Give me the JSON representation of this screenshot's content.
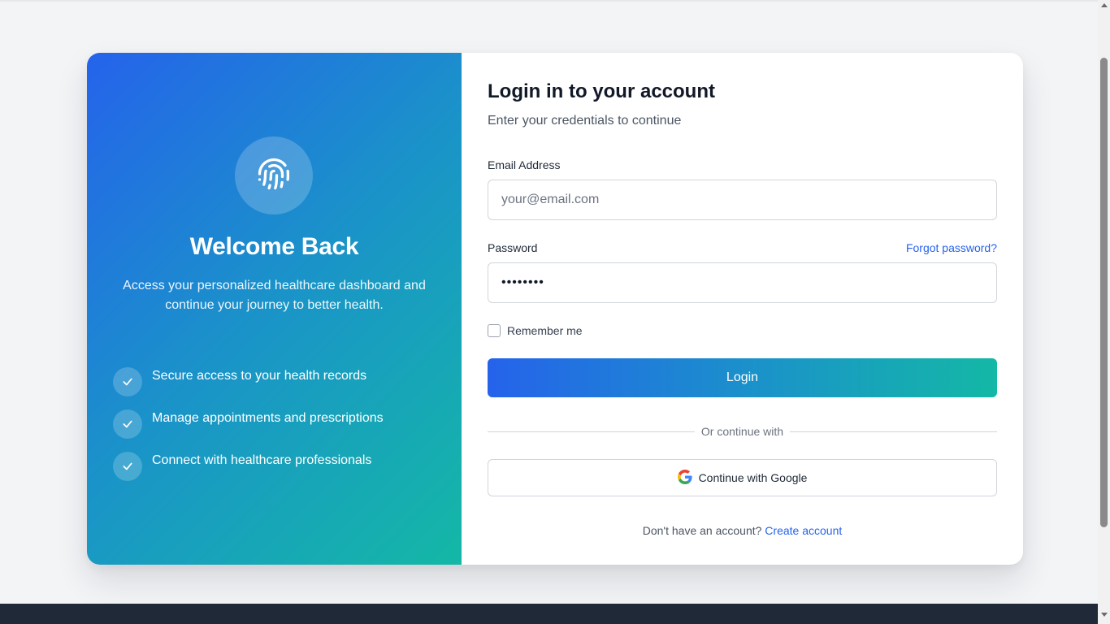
{
  "colors": {
    "brand_blue": "#2563eb",
    "brand_teal": "#14b8a6",
    "link": "#2563eb",
    "footer": "#1f2937"
  },
  "left": {
    "logo_icon": "fingerprint-icon",
    "title": "Welcome Back",
    "subtitle": "Access your personalized healthcare dashboard and continue your journey to better health.",
    "features": [
      {
        "icon": "check-icon",
        "text": "Secure access to your health records"
      },
      {
        "icon": "check-icon",
        "text": "Manage appointments and prescriptions"
      },
      {
        "icon": "check-icon",
        "text": "Connect with healthcare professionals"
      }
    ]
  },
  "form": {
    "title": "Login in to your account",
    "subtitle": "Enter your credentials to continue",
    "email_label": "Email Address",
    "email_placeholder": "your@email.com",
    "password_label": "Password",
    "password_value": "••••••••",
    "forgot_label": "Forgot password?",
    "remember_label": "Remember me",
    "remember_checked": false,
    "login_label": "Login",
    "divider_text": "Or continue with",
    "google_label": "Continue with Google",
    "google_icon": "google-icon",
    "signup_prompt": "Don't have an account?",
    "signup_link": "Create account"
  }
}
